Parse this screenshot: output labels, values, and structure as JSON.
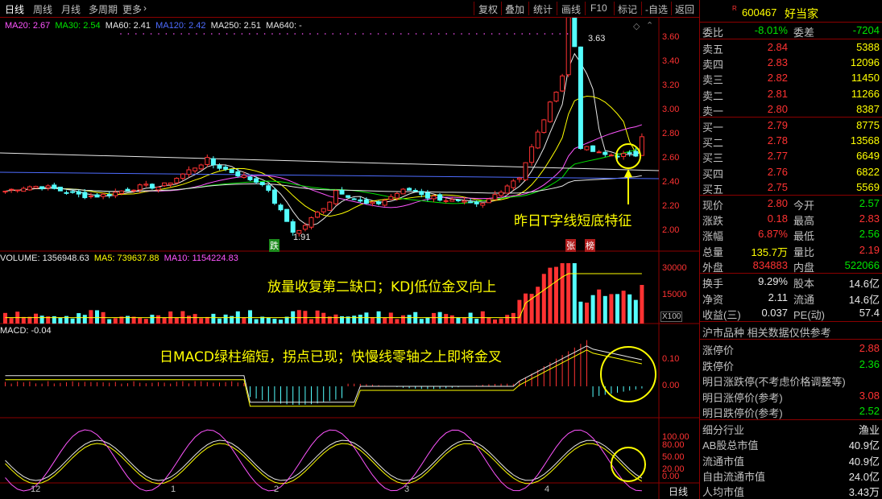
{
  "toolbar": {
    "tabs": [
      "日线",
      "周线",
      "月线",
      "多周期",
      "更多"
    ],
    "buttons": [
      "复权",
      "叠加",
      "统计",
      "画线",
      "F10",
      "标记",
      "-自选",
      "返回"
    ]
  },
  "ma_legend": {
    "ma20": "MA20: 2.67",
    "ma30": "MA30: 2.54",
    "ma60": "MA60: 2.41",
    "ma120": "MA120: 2.42",
    "ma250": "MA250: 2.51",
    "ma640": "MA640: -"
  },
  "volume_legend": {
    "vol": "VOLUME: 1356948.63",
    "ma5": "MA5: 739637.88",
    "ma10": "MA10: 1154224.83"
  },
  "macd_legend": "MACD: -0.04",
  "annotations": {
    "t_line": "昨日T字线短底特征",
    "volume": "放量收复第二缺口；KDJ低位金叉向上",
    "macd": "日MACD绿柱缩短，拐点已现；快慢线零轴之上即将金叉"
  },
  "markers": {
    "high": "3.63",
    "low": "1.91",
    "die": "跌",
    "zhang": "张",
    "bang": "榜"
  },
  "price_axis": [
    "3.60",
    "3.40",
    "3.20",
    "3.00",
    "2.80",
    "2.60",
    "2.40",
    "2.20",
    "2.00"
  ],
  "volume_axis": [
    "30000",
    "15000"
  ],
  "volume_unit": "X100",
  "macd_axis": [
    "0.10",
    "0.00"
  ],
  "kdj_axis": [
    "100.00",
    "80.00",
    "50.00",
    "20.00",
    "0.00"
  ],
  "date_axis": [
    "12",
    "1",
    "2",
    "3",
    "4"
  ],
  "period_label": "日线",
  "stock": {
    "badge": "R",
    "code": "600467",
    "name": "好当家"
  },
  "order_ratio": {
    "label1": "委比",
    "val1": "-8.01%",
    "label2": "委差",
    "val2": "-7204"
  },
  "asks": [
    {
      "label": "卖五",
      "price": "2.84",
      "vol": "5388"
    },
    {
      "label": "卖四",
      "price": "2.83",
      "vol": "12096"
    },
    {
      "label": "卖三",
      "price": "2.82",
      "vol": "11450"
    },
    {
      "label": "卖二",
      "price": "2.81",
      "vol": "11266"
    },
    {
      "label": "卖一",
      "price": "2.80",
      "vol": "8387"
    }
  ],
  "bids": [
    {
      "label": "买一",
      "price": "2.79",
      "vol": "8775"
    },
    {
      "label": "买二",
      "price": "2.78",
      "vol": "13568"
    },
    {
      "label": "买三",
      "price": "2.77",
      "vol": "6649"
    },
    {
      "label": "买四",
      "price": "2.76",
      "vol": "6822"
    },
    {
      "label": "买五",
      "price": "2.75",
      "vol": "5569"
    }
  ],
  "quote": [
    {
      "l1": "现价",
      "v1": "2.80",
      "c1": "red",
      "l2": "今开",
      "v2": "2.57",
      "c2": "green"
    },
    {
      "l1": "涨跌",
      "v1": "0.18",
      "c1": "red",
      "l2": "最高",
      "v2": "2.83",
      "c2": "red"
    },
    {
      "l1": "涨幅",
      "v1": "6.87%",
      "c1": "red",
      "l2": "最低",
      "v2": "2.56",
      "c2": "green"
    },
    {
      "l1": "总量",
      "v1": "135.7万",
      "c1": "yellow",
      "l2": "量比",
      "v2": "2.19",
      "c2": "red"
    },
    {
      "l1": "外盘",
      "v1": "834883",
      "c1": "red",
      "l2": "内盘",
      "v2": "522066",
      "c2": "green"
    }
  ],
  "fundamentals": [
    {
      "l1": "换手",
      "v1": "9.29%",
      "l2": "股本",
      "v2": "14.6亿"
    },
    {
      "l1": "净资",
      "v1": "2.11",
      "l2": "流通",
      "v2": "14.6亿"
    },
    {
      "l1": "收益(三)",
      "v1": "0.037",
      "l2": "PE(动)",
      "v2": "57.4"
    }
  ],
  "market_note": "沪市品种  相关数据仅供参考",
  "limits": [
    {
      "label": "涨停价",
      "value": "2.88",
      "color": "red"
    },
    {
      "label": "跌停价",
      "value": "2.36",
      "color": "green"
    },
    {
      "label": "明日涨跌停(不考虑价格调整等)",
      "value": "",
      "color": "white"
    },
    {
      "label": "明日涨停价(参考)",
      "value": "3.08",
      "color": "red"
    },
    {
      "label": "明日跌停价(参考)",
      "value": "2.52",
      "color": "green"
    }
  ],
  "industry": [
    {
      "label": "细分行业",
      "value": "渔业"
    },
    {
      "label": "AB股总市值",
      "value": "40.9亿"
    },
    {
      "label": "流通市值",
      "value": "40.9亿"
    },
    {
      "label": "自由流通市值",
      "value": "24.0亿"
    },
    {
      "label": "人均市值",
      "value": "3.43万"
    }
  ],
  "colors": {
    "up": "#ff3232",
    "down": "#54ffff",
    "accent": "#ffff00",
    "frame": "#8b0000"
  }
}
